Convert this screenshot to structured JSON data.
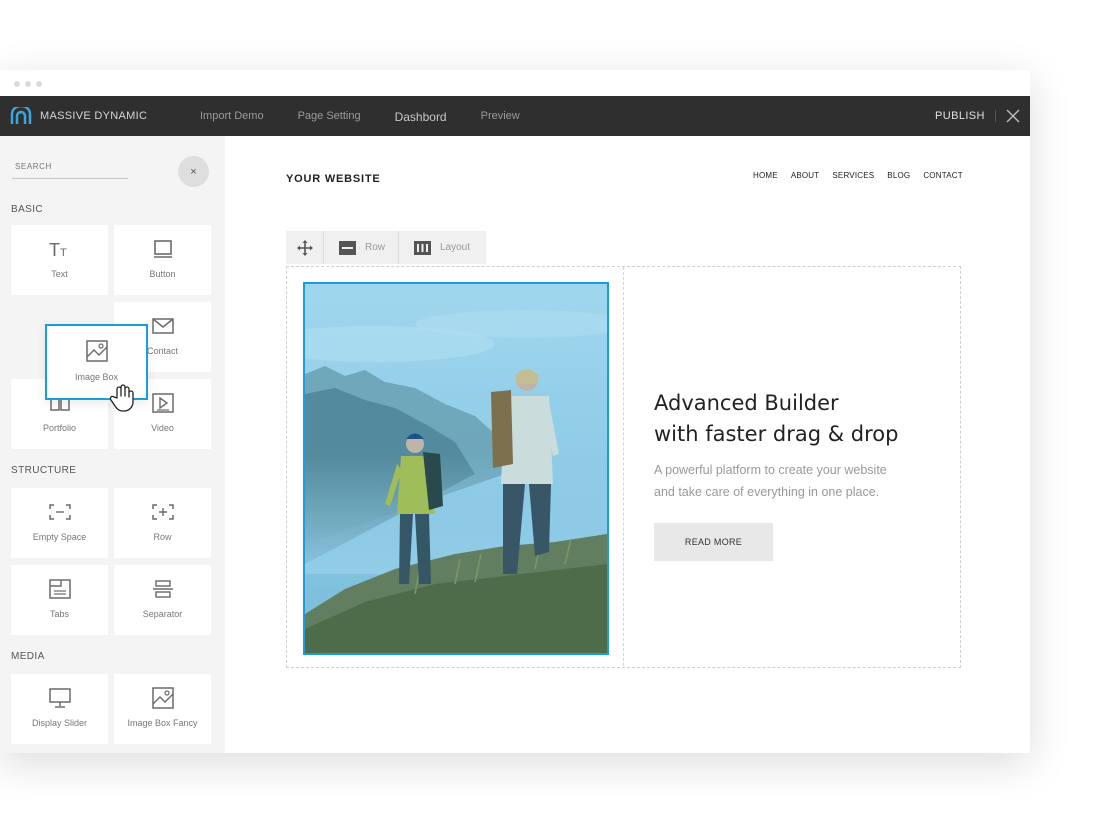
{
  "topbar": {
    "brand": "MASSIVE DYNAMIC",
    "menu": [
      "Import Demo",
      "Page Setting",
      "Dashbord",
      "Preview"
    ],
    "publish": "PUBLISH"
  },
  "sidebar": {
    "search_placeholder": "SEARCH",
    "clear_label": "×",
    "sections": {
      "basic": "BASIC",
      "structure": "STRUCTURE",
      "media": "MEDIA"
    },
    "tiles": {
      "text": "Text",
      "button": "Button",
      "contact": "Contact",
      "portfolio": "Portfolio",
      "video": "Video",
      "empty_space": "Empty Space",
      "row": "Row",
      "tabs": "Tabs",
      "separator": "Separator",
      "display_slider": "Display Slider",
      "image_box_fancy": "Image Box Fancy"
    },
    "dragging": "Image Box"
  },
  "canvas": {
    "site_title": "YOUR WEBSITE",
    "nav": [
      "HOME",
      "ABOUT",
      "SERVICES",
      "BLOG",
      "CONTACT"
    ],
    "toolbar": {
      "row": "Row",
      "layout": "Layout"
    },
    "headline_1": "Advanced Builder",
    "headline_2": "with faster drag & drop",
    "sub_1": "A powerful platform to create your website",
    "sub_2": "and take care of everything in one place.",
    "cta": "READ MORE"
  },
  "colors": {
    "accent": "#1a9ddb",
    "topbar": "#2f2f2f",
    "sidebar_bg": "#f4f4f4"
  }
}
